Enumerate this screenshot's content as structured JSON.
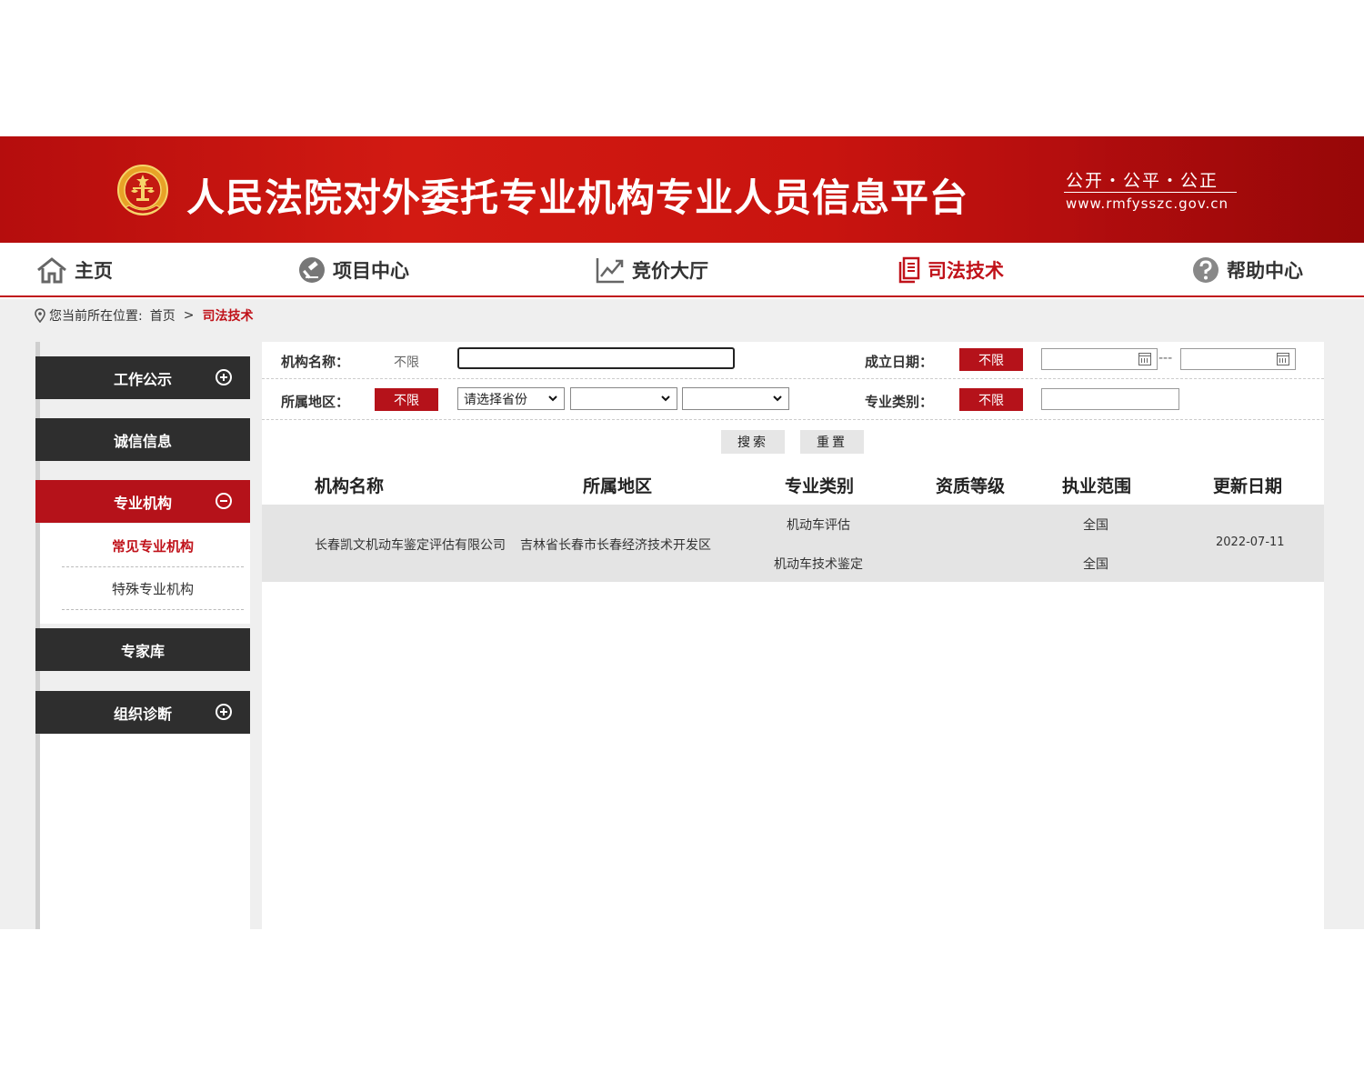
{
  "header": {
    "title": "人民法院对外委托专业机构专业人员信息平台",
    "slogan": "公开・公平・公正",
    "url": "www.rmfysszc.gov.cn"
  },
  "nav": {
    "items": [
      {
        "label": "主页",
        "icon": "home-icon"
      },
      {
        "label": "项目中心",
        "icon": "gavel-icon"
      },
      {
        "label": "竞价大厅",
        "icon": "trend-chart-icon"
      },
      {
        "label": "司法技术",
        "icon": "document-icon",
        "active": true
      },
      {
        "label": "帮助中心",
        "icon": "help-icon"
      }
    ]
  },
  "breadcrumb": {
    "prefix": "您当前所在位置:",
    "home": "首页",
    "separator": ">",
    "current": "司法技术"
  },
  "sidebar": {
    "items": [
      {
        "label": "工作公示",
        "toggle": "plus"
      },
      {
        "label": "诚信信息"
      },
      {
        "label": "专业机构",
        "toggle": "minus",
        "active": true
      },
      {
        "label": "专家库"
      },
      {
        "label": "组织诊断",
        "toggle": "plus"
      }
    ],
    "subitems": [
      {
        "label": "常见专业机构",
        "active": true
      },
      {
        "label": "特殊专业机构"
      }
    ]
  },
  "filters": {
    "org_name_label": "机构名称：",
    "org_name_default": "不限",
    "org_name_value": "",
    "founded_label": "成立日期：",
    "founded_tag": "不限",
    "date_from": "",
    "date_to": "",
    "date_separator": "---",
    "region_label": "所属地区：",
    "region_tag": "不限",
    "province_placeholder": "请选择省份",
    "city_value": "",
    "district_value": "",
    "category_label": "专业类别：",
    "category_tag": "不限",
    "category_value": ""
  },
  "buttons": {
    "search": "搜索",
    "reset": "重置"
  },
  "table": {
    "headers": [
      "机构名称",
      "所属地区",
      "专业类别",
      "资质等级",
      "执业范围",
      "更新日期"
    ],
    "rows": [
      {
        "name": "长春凯文机动车鉴定评估有限公司",
        "region": "吉林省长春市长春经济技术开发区",
        "categories": [
          "机动车评估",
          "机动车技术鉴定"
        ],
        "qualification": "",
        "scopes": [
          "全国",
          "全国"
        ],
        "updated": "2022-07-11"
      }
    ]
  },
  "colors": {
    "brand_red": "#b5121a",
    "sidebar_dark": "#2e2e2e"
  }
}
